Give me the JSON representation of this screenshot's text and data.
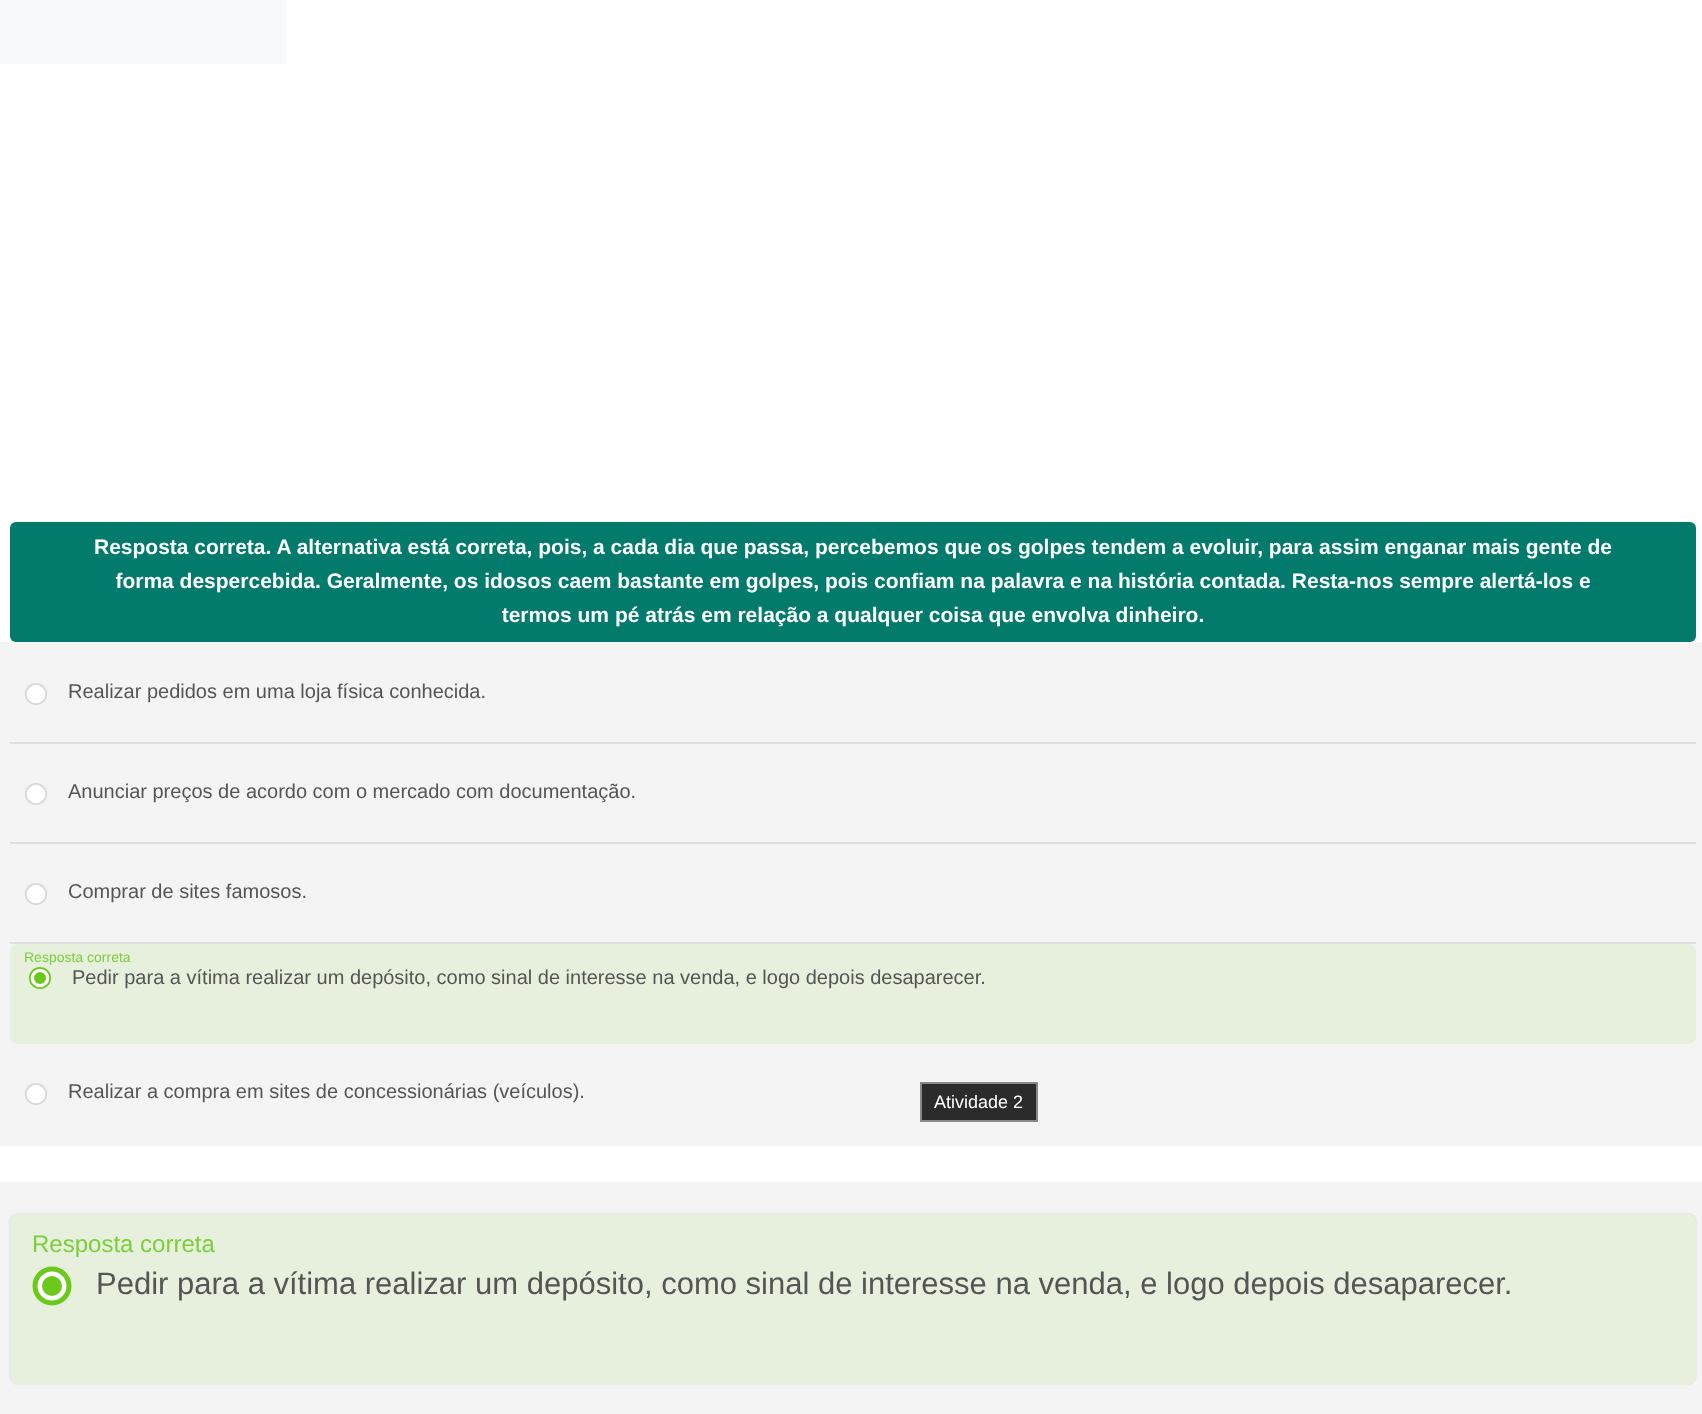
{
  "feedback": "Resposta correta. A alternativa está correta, pois, a cada dia que passa, percebemos que os golpes tendem a evoluir, para assim enganar mais gente de forma despercebida. Geralmente, os idosos caem bastante em golpes, pois confiam na palavra e na história contada. Resta-nos sempre alertá-los e termos um pé atrás em relação a qualquer coisa que envolva dinheiro.",
  "options": [
    {
      "label": "Realizar pedidos em uma loja física conhecida.",
      "selected": false,
      "correct": false
    },
    {
      "label": "Anunciar preços de acordo com o mercado com documentação.",
      "selected": false,
      "correct": false
    },
    {
      "label": "Comprar de sites famosos.",
      "selected": false,
      "correct": false
    },
    {
      "label": "Pedir para a vítima realizar um depósito, como sinal de interesse na venda, e logo depois desaparecer.",
      "selected": true,
      "correct": true,
      "note": "Resposta correta"
    },
    {
      "label": "Realizar a compra em sites de concessionárias (veículos).",
      "selected": false,
      "correct": false
    }
  ],
  "tooltip": "Atividade 2",
  "zoomed_answer": {
    "note": "Resposta correta",
    "label": "Pedir para a vítima realizar um depósito, como sinal de interesse na venda, e logo depois desaparecer.",
    "selected": true
  }
}
